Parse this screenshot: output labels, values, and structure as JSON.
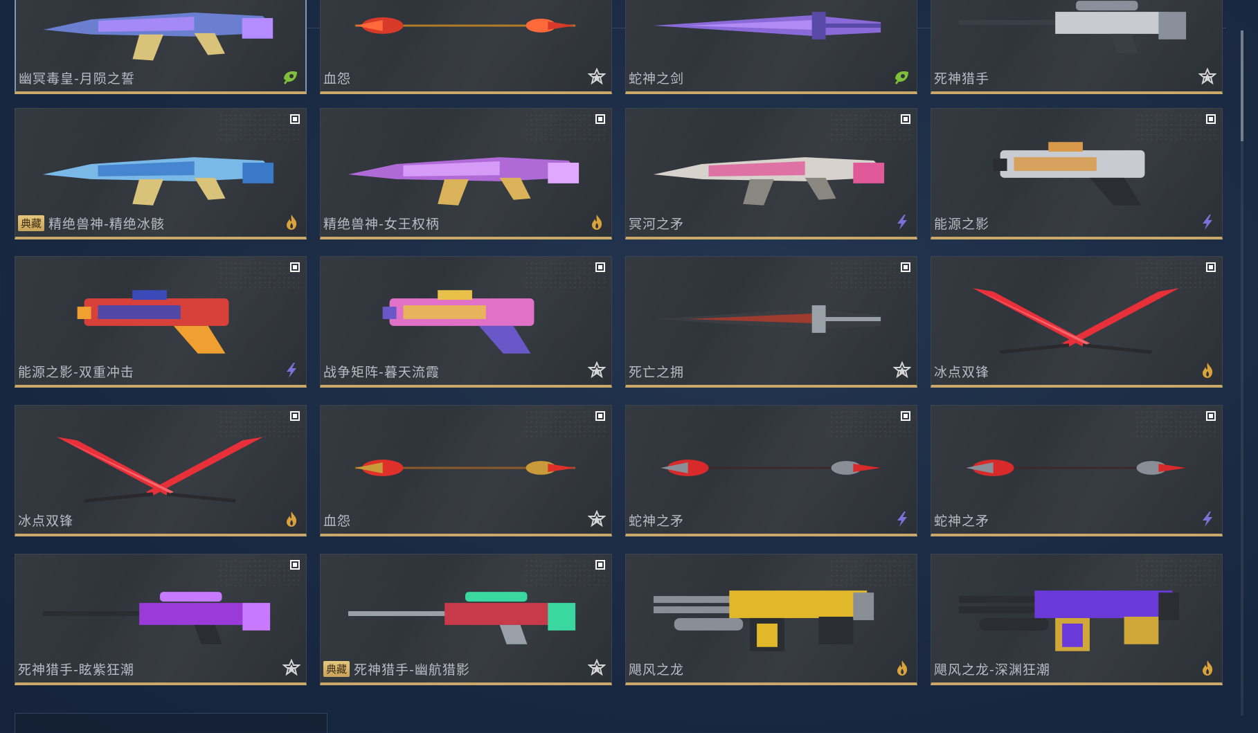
{
  "colors": {
    "background": "#1c2b43",
    "card": "#2e3339",
    "gold_line": "#c9a86a",
    "rank_gold": "#d9a23a",
    "rank_purple": "#7a72d8",
    "rank_green": "#7fbf3a",
    "rank_silver": "#d6d6d6"
  },
  "cards": [
    {
      "name": "幽冥毒皇-月陨之誓",
      "badge": "",
      "rank_icon": "green-leaf-icon",
      "weapon": "rifle-blue-purple",
      "checkbox": false,
      "selected": true
    },
    {
      "name": "血怨",
      "badge": "",
      "rank_icon": "silver-star-icon",
      "weapon": "staff-red",
      "checkbox": false,
      "selected": false
    },
    {
      "name": "蛇神之剑",
      "badge": "",
      "rank_icon": "green-leaf-icon",
      "weapon": "sword-purple",
      "checkbox": false,
      "selected": false
    },
    {
      "name": "死神猎手",
      "badge": "",
      "rank_icon": "silver-star-icon",
      "weapon": "sniper-silver",
      "checkbox": false,
      "selected": false
    },
    {
      "name": "精绝兽神-精绝冰骸",
      "badge": "典藏",
      "rank_icon": "gold-flame-icon",
      "weapon": "rifle-ice",
      "checkbox": true,
      "selected": false
    },
    {
      "name": "精绝兽神-女王权柄",
      "badge": "",
      "rank_icon": "gold-flame-icon",
      "weapon": "rifle-purple-gold",
      "checkbox": true,
      "selected": false
    },
    {
      "name": "冥河之矛",
      "badge": "",
      "rank_icon": "purple-bolt-icon",
      "weapon": "rifle-white-pink",
      "checkbox": true,
      "selected": false
    },
    {
      "name": "能源之影",
      "badge": "",
      "rank_icon": "purple-bolt-icon",
      "weapon": "pistol-silver",
      "checkbox": true,
      "selected": false
    },
    {
      "name": "能源之影-双重冲击",
      "badge": "",
      "rank_icon": "purple-bolt-icon",
      "weapon": "pistol-red-blue",
      "checkbox": true,
      "selected": false
    },
    {
      "name": "战争矩阵-暮天流霞",
      "badge": "",
      "rank_icon": "silver-star-icon",
      "weapon": "pistol-pink-gold",
      "checkbox": true,
      "selected": false
    },
    {
      "name": "死亡之拥",
      "badge": "",
      "rank_icon": "silver-star-icon",
      "weapon": "sword-dark-red",
      "checkbox": true,
      "selected": false
    },
    {
      "name": "冰点双锋",
      "badge": "",
      "rank_icon": "gold-flame-icon",
      "weapon": "dual-blades-red",
      "checkbox": true,
      "selected": false
    },
    {
      "name": "冰点双锋",
      "badge": "",
      "rank_icon": "gold-flame-icon",
      "weapon": "dual-blades-red",
      "checkbox": true,
      "selected": false
    },
    {
      "name": "血怨",
      "badge": "",
      "rank_icon": "silver-star-icon",
      "weapon": "staff-red-gold",
      "checkbox": true,
      "selected": false
    },
    {
      "name": "蛇神之矛",
      "badge": "",
      "rank_icon": "purple-bolt-icon",
      "weapon": "spear-red",
      "checkbox": true,
      "selected": false
    },
    {
      "name": "蛇神之矛",
      "badge": "",
      "rank_icon": "purple-bolt-icon",
      "weapon": "spear-red",
      "checkbox": true,
      "selected": false
    },
    {
      "name": "死神猎手-眩紫狂潮",
      "badge": "",
      "rank_icon": "silver-star-icon",
      "weapon": "sniper-purple",
      "checkbox": true,
      "selected": false
    },
    {
      "name": "死神猎手-幽航猎影",
      "badge": "典藏",
      "rank_icon": "silver-star-icon",
      "weapon": "sniper-red-green",
      "checkbox": true,
      "selected": false
    },
    {
      "name": "飓风之龙",
      "badge": "",
      "rank_icon": "gold-flame-icon",
      "weapon": "gatling-gold",
      "checkbox": false,
      "selected": false
    },
    {
      "name": "飓风之龙-深渊狂潮",
      "badge": "",
      "rank_icon": "gold-flame-icon",
      "weapon": "gatling-purple",
      "checkbox": false,
      "selected": false
    }
  ]
}
